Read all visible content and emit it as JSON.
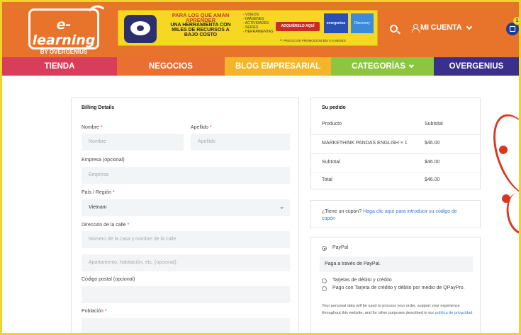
{
  "header": {
    "logo_text": "e-learning",
    "logo_sub": "BY OVERGENIUS",
    "banner": {
      "headline_1": "PARA LOS QUE AMAN",
      "headline_2": "APRENDER",
      "headline_3": "UNA HERRAMIENTA CON",
      "headline_4": "MILES DE RECURSOS A",
      "headline_5": "BAJO COSTO",
      "list": [
        "- VIDEOS",
        "- IMÁGENES",
        "- ACTIVIDADES",
        "- SERIES",
        "- HERRAMIENTAS"
      ],
      "cta": "ADQUIÉRELO AQUÍ",
      "brand_1": "overgenius",
      "brand_2": "Discovery",
      "price_note": "** PRECIO DE PROMOCIÓN $25 X 6 MESES"
    },
    "account_label": "MI CUENTA",
    "cart_count": "1"
  },
  "nav": {
    "items": [
      "TIENDA",
      "NEGOCIOS",
      "BLOG EMPRESARIAL",
      "CATEGORÍAS",
      "OVERGENIUS"
    ],
    "colors": [
      "#d83d5c",
      "#ea6f33",
      "#f5b52b",
      "#8dc540",
      "#3a2f8a"
    ]
  },
  "billing": {
    "title": "Billing Details",
    "nombre_label": "Nombre",
    "nombre_placeholder": "Nombre",
    "apellido_label": "Apellido",
    "apellido_placeholder": "Apellido",
    "empresa_label": "Empresa (opcional)",
    "empresa_placeholder": "Empresa",
    "pais_label": "País / Región",
    "pais_value": "Vietnam",
    "direccion_label": "Dirección de la calle",
    "direccion_placeholder": "Número de la casa y nombre de la calle",
    "direccion2_placeholder": "Apartamento, habitación, etc. (opcional)",
    "postal_label": "Código postal (opcional)",
    "poblacion_label": "Población",
    "required_mark": "*"
  },
  "order": {
    "title": "Su pedido",
    "col_product": "Producto",
    "col_subtotal": "Subtotal",
    "item_name": "MARKETHINK PANDAS ENGLISH",
    "item_qty": "× 1",
    "item_price": "$46.00",
    "subtotal_label": "Subtotal",
    "subtotal_value": "$46.00",
    "total_label": "Total",
    "total_value": "$46.00"
  },
  "coupon": {
    "prefix": "¿Tiene un cupón?",
    "link": "Haga clic aquí para introducir su código de cupón"
  },
  "payment": {
    "method_1": "PayPal",
    "method_1_desc": "Paga a través de PayPal.",
    "method_2": "Tarjetas de débito y crédito",
    "method_3": "Pago con Tarjeta de crédito y débito por medio de QPayPro.",
    "privacy_text": "Your personal data will be used to process your order, support your experience throughout this website, and for other purposes described in our",
    "privacy_link": "política de privacidad."
  },
  "colors": {
    "header_orange": "#e8732a",
    "frame_yellow": "#f2d22e",
    "required_red": "#d0302b",
    "link_blue": "#3a78c8"
  }
}
